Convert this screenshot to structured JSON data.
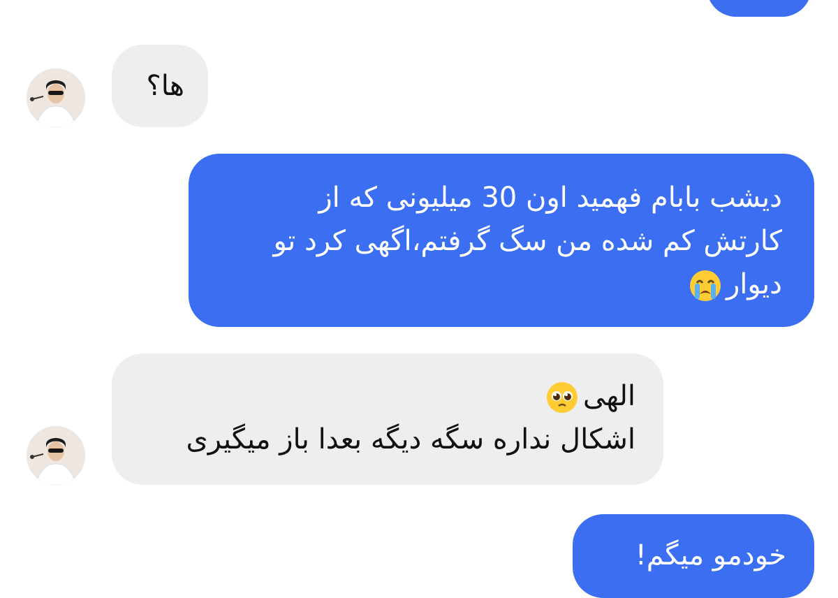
{
  "chat": {
    "messages": [
      {
        "side": "out",
        "lines": []
      },
      {
        "side": "in",
        "lines": [
          "ها؟"
        ]
      },
      {
        "side": "out",
        "lines": [
          "دیشب بابام فهمید اون 30 میلیونی که از",
          "کارتش کم شده من سگ گرفتم،اگهی کرد تو",
          "دیوار"
        ],
        "emoji": "loudly-crying-face"
      },
      {
        "side": "in",
        "lines": [
          "الهی",
          "اشکال نداره سگه دیگه بعدا باز میگیری"
        ],
        "emoji": "pleading-face"
      },
      {
        "side": "out",
        "lines": [
          "خودمو میگم!"
        ]
      }
    ]
  },
  "colors": {
    "outgoing_bubble": "#3b6ef1",
    "incoming_bubble": "#eeeeef",
    "outgoing_text": "#ffffff",
    "incoming_text": "#111111"
  }
}
